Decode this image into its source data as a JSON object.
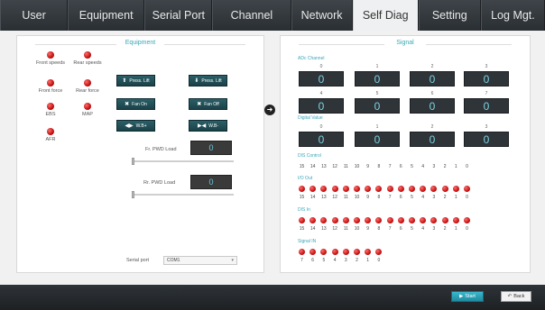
{
  "tabs": [
    "User",
    "Equipment",
    "Serial Port",
    "Channel",
    "Network",
    "Self Diag",
    "Setting",
    "Log Mgt."
  ],
  "active_tab": 5,
  "equipment": {
    "title": "Equipment",
    "indicators": [
      "Front speeds",
      "Rear speeds",
      "Front force",
      "Rear force",
      "EBS",
      "MAP",
      "AFR"
    ],
    "buttons": [
      {
        "icon": "up-arrow-icon",
        "glyph": "⬆",
        "label": "Press. Lift"
      },
      {
        "icon": "down-arrow-icon",
        "glyph": "⬇",
        "label": "Press. Lift"
      },
      {
        "icon": "fan-icon",
        "glyph": "✖",
        "label": "Fan On"
      },
      {
        "icon": "fan-icon",
        "glyph": "✖",
        "label": "Fan Off"
      },
      {
        "icon": "expand-icon",
        "glyph": "◀▶",
        "label": "W.B+"
      },
      {
        "icon": "compress-icon",
        "glyph": "▶◀",
        "label": "W.B-"
      }
    ],
    "fr_pwd_label": "Fr. PWD Load",
    "fr_pwd_value": "0",
    "rr_pwd_label": "Rr. PWD Load",
    "rr_pwd_value": "0",
    "serial_port_label": "Serial port",
    "serial_port_value": "COM1"
  },
  "signal": {
    "title": "Signal",
    "adc_label": "ADc Channel",
    "adc_channels": [
      "0",
      "1",
      "2",
      "3",
      "4",
      "5",
      "6",
      "7"
    ],
    "adc_values": [
      "0",
      "0",
      "0",
      "0",
      "0",
      "0",
      "0",
      "0"
    ],
    "digital_label": "Digital Value",
    "digital_channels": [
      "0",
      "1",
      "2",
      "3"
    ],
    "digital_values": [
      "0",
      "0",
      "0",
      "0"
    ],
    "ctrl_label": "DIS Control",
    "ctrl_bits": [
      "15",
      "14",
      "13",
      "12",
      "11",
      "10",
      "9",
      "8",
      "7",
      "6",
      "5",
      "4",
      "3",
      "2",
      "1",
      "0"
    ],
    "out_label": "I/O Out",
    "out_bits": [
      "15",
      "14",
      "13",
      "12",
      "11",
      "10",
      "9",
      "8",
      "7",
      "6",
      "5",
      "4",
      "3",
      "2",
      "1",
      "0"
    ],
    "in_label": "DIS In",
    "in_bits": [
      "15",
      "14",
      "13",
      "12",
      "11",
      "10",
      "9",
      "8",
      "7",
      "6",
      "5",
      "4",
      "3",
      "2",
      "1",
      "0"
    ],
    "sig_label": "Signal IN",
    "sig_bits": [
      "7",
      "6",
      "5",
      "4",
      "3",
      "2",
      "1",
      "0"
    ]
  },
  "bottom": {
    "start_label": "Start",
    "back_label": "Back"
  },
  "colors": {
    "accent": "#3aa6b8",
    "led_red": "#c41414",
    "value_text": "#7bd3e3"
  }
}
